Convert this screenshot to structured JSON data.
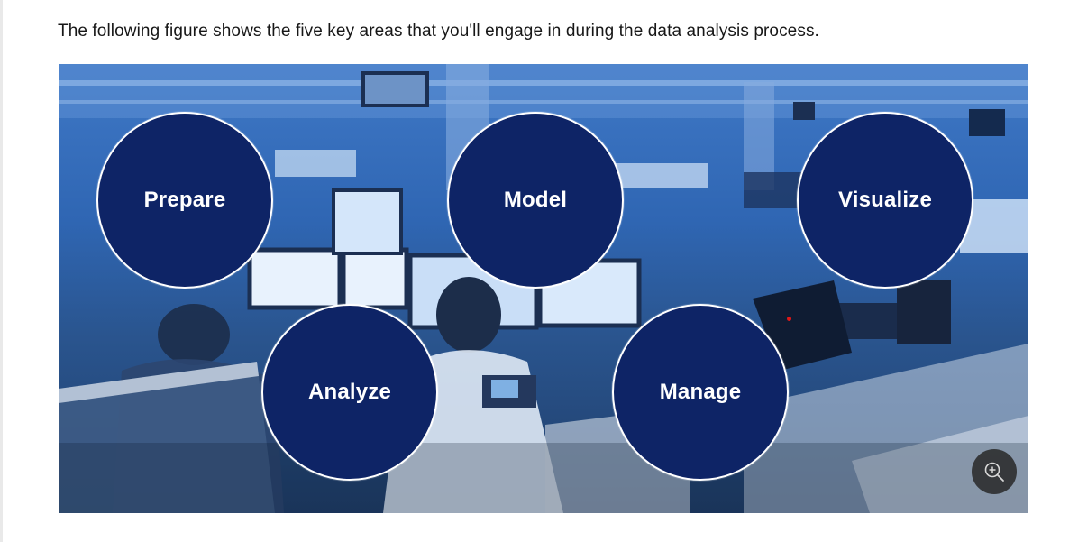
{
  "intro_text": "The following figure shows the five key areas that you'll engage in during the data analysis process.",
  "figure": {
    "areas": [
      {
        "label": "Prepare"
      },
      {
        "label": "Model"
      },
      {
        "label": "Visualize"
      },
      {
        "label": "Analyze"
      },
      {
        "label": "Manage"
      }
    ],
    "zoom_icon": "zoom-in-icon"
  },
  "colors": {
    "circle_fill": "#0e2466",
    "circle_border": "#ffffff",
    "photo_tint": "#2f66b3",
    "text": "#171717"
  }
}
